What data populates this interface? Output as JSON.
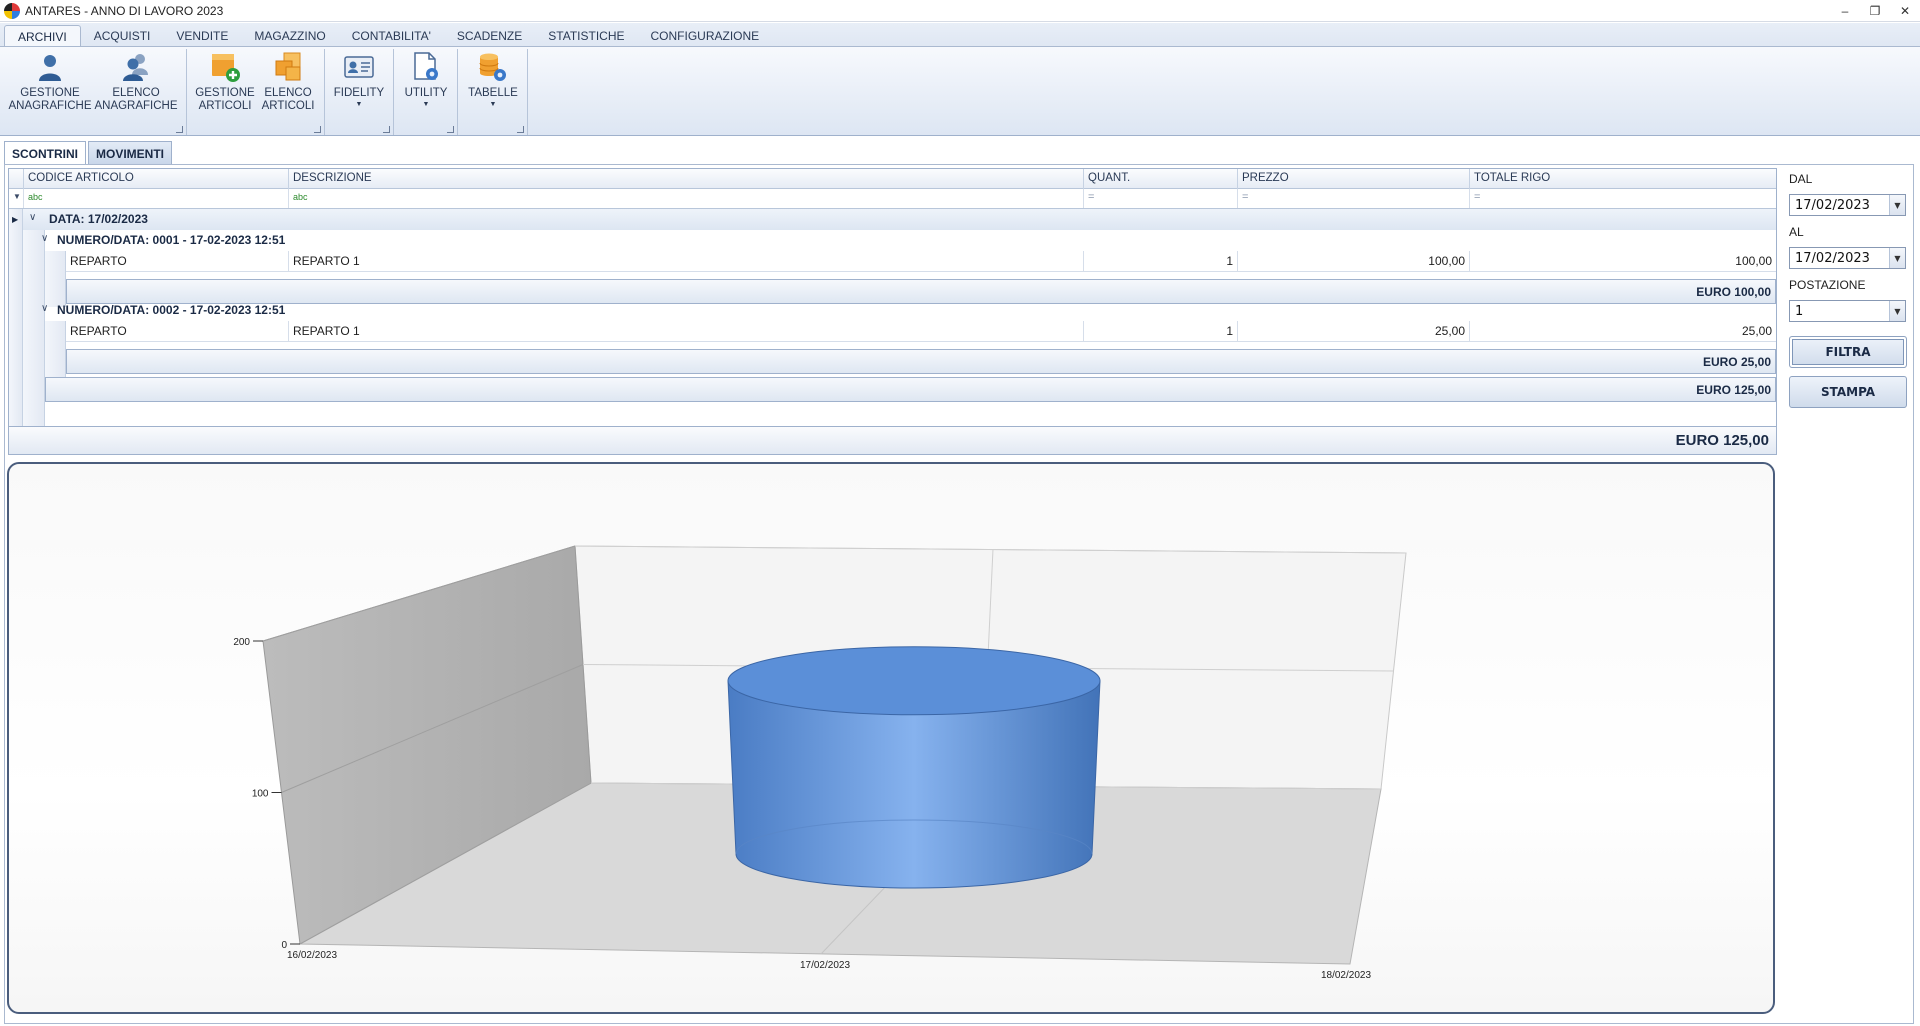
{
  "window": {
    "title": "ANTARES - ANNO DI LAVORO 2023"
  },
  "ribbon": {
    "tabs": [
      "ARCHIVI",
      "ACQUISTI",
      "VENDITE",
      "MAGAZZINO",
      "CONTABILITA'",
      "SCADENZE",
      "STATISTICHE",
      "CONFIGURAZIONE"
    ],
    "active_tab": "ARCHIVI",
    "buttons": [
      {
        "label": "GESTIONE\nANAGRAFICHE",
        "icon": "person-icon"
      },
      {
        "label": "ELENCO\nANAGRAFICHE",
        "icon": "people-icon"
      },
      {
        "label": "GESTIONE\nARTICOLI",
        "icon": "add-article-icon"
      },
      {
        "label": "ELENCO\nARTICOLI",
        "icon": "articles-icon"
      },
      {
        "label": "FIDELITY",
        "icon": "fidelity-card-icon"
      },
      {
        "label": "UTILITY",
        "icon": "utility-gear-icon"
      },
      {
        "label": "TABELLE",
        "icon": "database-gear-icon"
      }
    ]
  },
  "inner_tabs": [
    "SCONTRINI",
    "MOVIMENTI"
  ],
  "grid": {
    "columns": [
      "CODICE ARTICOLO",
      "DESCRIZIONE",
      "QUANT.",
      "PREZZO",
      "TOTALE RIGO"
    ],
    "date_group": "DATA: 17/02/2023",
    "receipts": [
      {
        "header": "NUMERO/DATA: 0001 - 17-02-2023 12:51",
        "rows": [
          {
            "codice": "REPARTO",
            "descrizione": "REPARTO 1",
            "quant": "1",
            "prezzo": "100,00",
            "totale": "100,00"
          }
        ],
        "subtotal": "EURO 100,00"
      },
      {
        "header": "NUMERO/DATA: 0002 - 17-02-2023 12:51",
        "rows": [
          {
            "codice": "REPARTO",
            "descrizione": "REPARTO 1",
            "quant": "1",
            "prezzo": "25,00",
            "totale": "25,00"
          }
        ],
        "subtotal": "EURO 25,00"
      }
    ],
    "date_total": "EURO 125,00",
    "grand_total": "EURO 125,00"
  },
  "filters": {
    "dal_label": "DAL",
    "dal_value": "17/02/2023",
    "al_label": "AL",
    "al_value": "17/02/2023",
    "postazione_label": "POSTAZIONE",
    "postazione_value": "1",
    "filtra_label": "FILTRA",
    "stampa_label": "STAMPA"
  },
  "chart_data": {
    "type": "bar",
    "style": "3d-cylinder",
    "categories": [
      "16/02/2023",
      "17/02/2023",
      "18/02/2023"
    ],
    "values": [
      null,
      125,
      null
    ],
    "yticks": [
      0,
      100,
      200
    ],
    "ylim": [
      0,
      200
    ],
    "color": "#5b8fd8",
    "grid": true
  }
}
